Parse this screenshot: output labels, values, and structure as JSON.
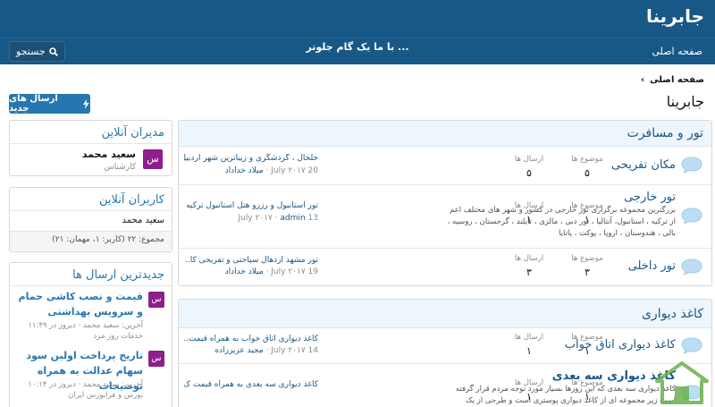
{
  "header": {
    "logo": "جابرینا"
  },
  "navbar": {
    "home": "صفحه اصلی",
    "tagline": "با ما یک گام جلوتر ...",
    "search": "جستجو"
  },
  "breadcrumb": {
    "home": "صفحه اصلی",
    "separator": "›"
  },
  "page": {
    "title": "جابرینا",
    "post_button": "ارسال های جدید"
  },
  "colors": {
    "header": "#185886",
    "accent": "#2577b1",
    "avatar": "#8c1f8c",
    "category_bg": "#edf6fd"
  },
  "sidebar": {
    "staff": {
      "title": "مدیران آنلاین",
      "avatar": "س",
      "name": "سعید محمد",
      "role": "کارشناس"
    },
    "online": {
      "title": "کاربران آنلاین",
      "name": "سعید محمد",
      "stats": "مجموع: ۲۲ (کاربر: ۱، مهمان: ۲۱)"
    },
    "latest": {
      "title": "جدیدترین ارسال ها",
      "items": [
        {
          "avatar": "س",
          "title": "قیمت و نصب کاشی حمام و سرویس بهداشتی",
          "meta1": "آخرین: سعید محمد · دیروز در ۱۱:۴۹",
          "meta2": "خدمات روز مزد"
        },
        {
          "avatar": "س",
          "title": "تاریخ پرداخت اولین سود سهام عدالت به همراه توضیحات",
          "meta1": "آخرین: سعید محمد · دیروز در ۱۰:۱۴",
          "meta2": "بورس و فرابورس ایران"
        }
      ]
    }
  },
  "labels": {
    "threads": "موضوع ها",
    "posts": "ارسال ها"
  },
  "categories": [
    {
      "title": "تور و مسافرت",
      "nodes": [
        {
          "title": "مکان تفریحی",
          "desc": "",
          "threads": "۵",
          "posts": "۵",
          "last_title": "خلخال ، گردشگری و زیباترین شهر اردبیل",
          "last_date": "20 July ۲۰۱۷",
          "last_user": "میلاد خداداد"
        },
        {
          "title": "تور خارجی",
          "desc": "بزرگترین مجموعه برگزاری تور خارجی در کشور و شهر های مختلف اعم از ترکیه ، استانبول، آنتالیا ، تور دبی ، مالزی ، تایلند ، گرجستان ، روسیه ، بالی ، هندوستان ، اروپا ، پوکت ، پاتایا",
          "threads": "۱",
          "posts": "۱",
          "last_title": "تور استانبول و رزرو هتل استانبول ترکیه ...",
          "last_date": "13 July ۲۰۱۷",
          "last_user": "admin"
        },
        {
          "title": "تور داخلی",
          "desc": "",
          "threads": "۳",
          "posts": "۳",
          "last_title": "تور مشهد اردهال سیاحتی و تفریحی کا...",
          "last_date": "19 July ۲۰۱۷",
          "last_user": "میلاد خداداد"
        }
      ]
    },
    {
      "title": "کاغذ دیواری",
      "nodes": [
        {
          "title": "کاغذ دیواری اتاق خواب",
          "desc": "",
          "threads": "۱",
          "posts": "۱",
          "last_title": "کاغذ دیواری اتاق خواب به همراه قیمت...",
          "last_date": "14 July ۲۰۱۷",
          "last_user": "مجید عزیززاده"
        },
        {
          "title": "کاغذ دیواری سه بعدی",
          "desc": "کاغذ دیواری سه بعدی که این روزها بسیار مورد توجه مردم قرار گرفته است زیر مجموعه ای از کاغذ دیواری پوستری است و طرحی از یک",
          "threads": "۱",
          "posts": "۱",
          "last_title": "کاغذ دیواری سه بعدی به همراه قیمت ک",
          "last_date": "",
          "last_user": ""
        }
      ]
    }
  ]
}
